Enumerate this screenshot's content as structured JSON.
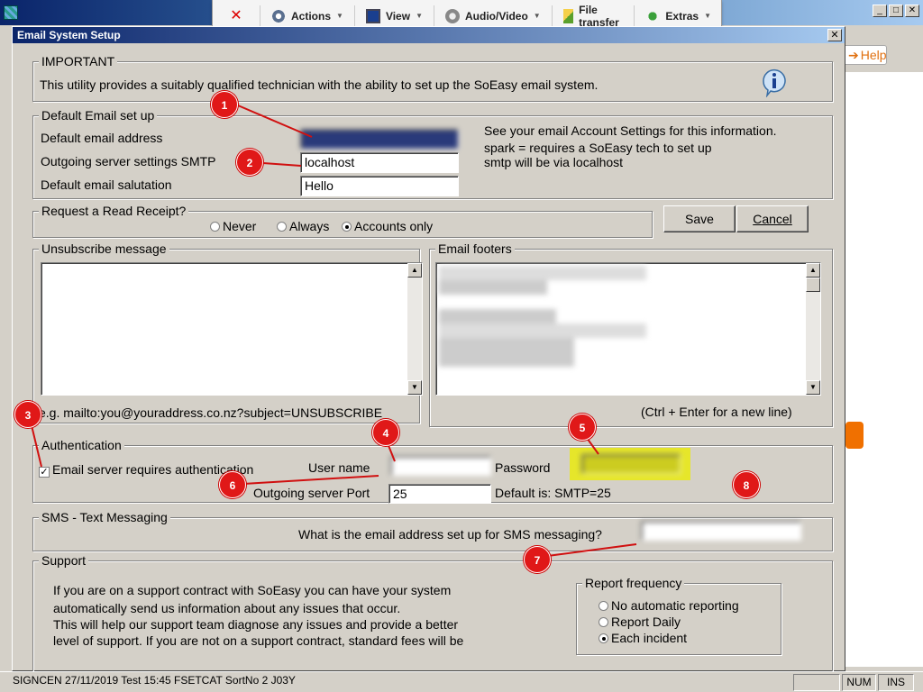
{
  "remote_toolbar": {
    "actions": "Actions",
    "view": "View",
    "audio_video": "Audio/Video",
    "file_transfer": "File transfer",
    "extras": "Extras"
  },
  "background_app": {
    "help_label": "Help"
  },
  "dialog": {
    "title": "Email System Setup",
    "important": {
      "legend": "IMPORTANT",
      "text": "This utility provides a suitably qualified technician with the ability to set up the SoEasy email system."
    },
    "default_email": {
      "legend": "Default Email set up",
      "address_label": "Default email address",
      "address_value": "",
      "smtp_label": "Outgoing server settings SMTP",
      "smtp_value": "localhost",
      "salutation_label": "Default email salutation",
      "salutation_value": "Hello",
      "info_1": "See your email Account Settings for this information.",
      "info_2": "spark = requires a SoEasy tech to set up",
      "info_3": "smtp will be via localhost"
    },
    "read_receipt": {
      "legend": "Request a Read Receipt?",
      "options": [
        "Never",
        "Always",
        "Accounts only"
      ],
      "selected": "Accounts only"
    },
    "buttons": {
      "save": "Save",
      "cancel": "Cancel"
    },
    "unsubscribe": {
      "legend": "Unsubscribe message",
      "value": "",
      "hint": "e.g. mailto:you@youraddress.co.nz?subject=UNSUBSCRIBE"
    },
    "footers": {
      "legend": "Email footers",
      "hint": "(Ctrl + Enter for a new line)"
    },
    "authentication": {
      "legend": "Authentication",
      "requires_auth_label": "Email server requires authentication",
      "requires_auth_checked": true,
      "username_label": "User name",
      "password_label": "Password",
      "port_label": "Outgoing server Port",
      "port_value": "25",
      "port_default": "Default is: SMTP=25"
    },
    "sms": {
      "legend": "SMS - Text Messaging",
      "question": "What is the email address set up for SMS messaging?"
    },
    "support": {
      "legend": "Support",
      "line_1": "If you are on a support contract with SoEasy you can have your system",
      "line_2": "automatically send us information about any issues that occur.",
      "line_3": "This will help our support team diagnose any issues and provide a better",
      "line_4": "level of support. If you are not on a support contract, standard fees will be",
      "report_legend": "Report frequency",
      "report_options": [
        "No automatic reporting",
        "Report Daily",
        "Each incident"
      ],
      "report_selected": "Each incident"
    }
  },
  "annotations": [
    "1",
    "2",
    "3",
    "4",
    "5",
    "6",
    "7",
    "8"
  ],
  "statusbar": {
    "text": "SIGNCEN  27/11/2019 Test 15:45 FSETCAT SortNo      2 J03Y",
    "num": "NUM",
    "ins": "INS"
  },
  "colors": {
    "highlight": "#e6e62a",
    "annotation": "#e01818",
    "title_bar": "#0a246a"
  }
}
